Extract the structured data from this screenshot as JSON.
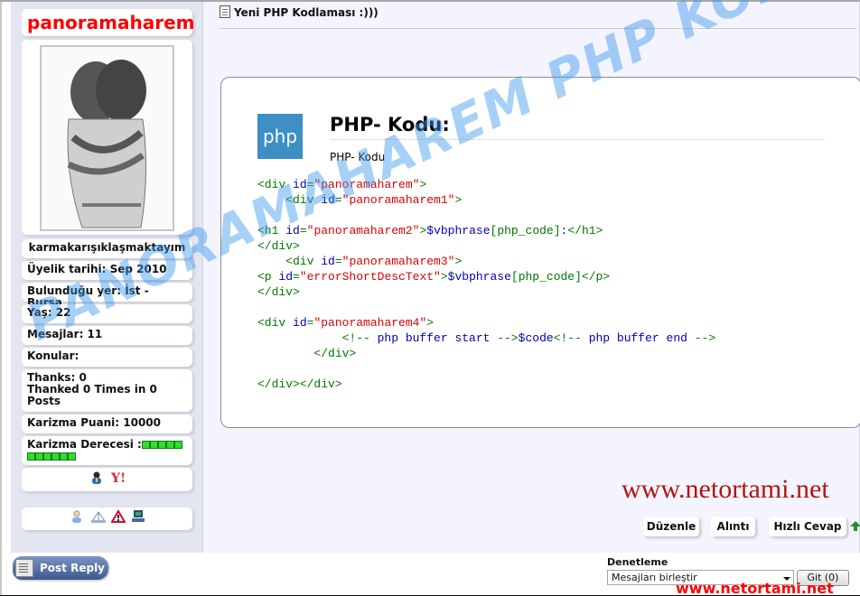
{
  "user": {
    "username": "panoramaharem",
    "title": "karmakarışıklaşmaktayım",
    "join_date": "Üyelik tarihi: Sep 2010",
    "location": "Bulunduğu yer: İst - Bursa",
    "age": "Yaş: 22",
    "posts": "Mesajlar: 11",
    "topics": "Konular:",
    "thanks": "Thanks: 0",
    "thanked": "Thanked 0 Times in 0 Posts",
    "karizma_points": "Karizma Puani: 10000",
    "karizma_level_label": "Karizma Derecesi :",
    "karizma_level_bars": 11,
    "contact_icons": [
      "msn-icon",
      "yahoo-icon"
    ],
    "action_icons": [
      "profile-icon",
      "network-icon",
      "report-icon",
      "computer-icon"
    ]
  },
  "post": {
    "title": "Yeni PHP Kodlaması :)))",
    "code_heading": "PHP- Kodu:",
    "code_subheading": "PHP- Kodu",
    "logo_text": "php",
    "code_lines": [
      [
        [
          "tg",
          "<div "
        ],
        [
          "kw",
          "id"
        ],
        [
          "tg",
          "="
        ],
        [
          "st",
          "\"panoramaharem\""
        ],
        [
          "tg",
          ">"
        ]
      ],
      [
        [
          "tg",
          "    <div "
        ],
        [
          "kw",
          "id"
        ],
        [
          "tg",
          "="
        ],
        [
          "st",
          "\"panoramaharem1\""
        ],
        [
          "tg",
          ">"
        ]
      ],
      [],
      [
        [
          "tg",
          "<h1 "
        ],
        [
          "kw",
          "id"
        ],
        [
          "tg",
          "="
        ],
        [
          "st",
          "\"panoramaharem2\""
        ],
        [
          "tg",
          ">"
        ],
        [
          "kw",
          "$vbphrase"
        ],
        [
          "tg",
          "["
        ],
        [
          "tg",
          "php_code"
        ],
        [
          "tg",
          "]"
        ],
        [
          "kw",
          ":"
        ],
        [
          "tg",
          "</h1>"
        ]
      ],
      [
        [
          "tg",
          "</div>"
        ]
      ],
      [
        [
          "tg",
          "    <div "
        ],
        [
          "kw",
          "id"
        ],
        [
          "tg",
          "="
        ],
        [
          "st",
          "\"panoramaharem3\""
        ],
        [
          "tg",
          ">"
        ]
      ],
      [
        [
          "tg",
          "<p "
        ],
        [
          "kw",
          "id"
        ],
        [
          "tg",
          "="
        ],
        [
          "st",
          "\"errorShortDescText\""
        ],
        [
          "tg",
          ">"
        ],
        [
          "kw",
          "$vbphrase"
        ],
        [
          "tg",
          "[php_code]"
        ],
        [
          "tg",
          "</p>"
        ]
      ],
      [
        [
          "tg",
          "</div>"
        ]
      ],
      [],
      [
        [
          "tg",
          "<div "
        ],
        [
          "kw",
          "id"
        ],
        [
          "tg",
          "="
        ],
        [
          "st",
          "\"panoramaharem4\""
        ],
        [
          "tg",
          ">"
        ]
      ],
      [
        [
          "tg",
          "            <!-- "
        ],
        [
          "cm",
          "php buffer start"
        ],
        [
          "tg",
          " -->"
        ],
        [
          "kw",
          "$code"
        ],
        [
          "tg",
          "<!-- "
        ],
        [
          "cm",
          "php buffer end"
        ],
        [
          "tg",
          " -->"
        ]
      ],
      [
        [
          "tg",
          "        </div>"
        ]
      ],
      [],
      [
        [
          "tg",
          "</div></div>"
        ]
      ]
    ],
    "site_watermark": "www.netortami.net",
    "watermark_overlay": "PANORAMAHAREM PHP KODLAMASI"
  },
  "buttons": {
    "edit": "Düzenle",
    "quote": "Alıntı",
    "quick_reply": "Hızlı Cevap",
    "post_reply": "Post Reply"
  },
  "moderation": {
    "label": "Denetleme",
    "selected_option": "Mesajları birleştir",
    "go_button": "Git (0)"
  },
  "footer_site": "www.netortami.net",
  "colors": {
    "username": "#ff0000",
    "sidebar_bg": "#e3e5f1",
    "content_bg": "#f3f4fd",
    "site_mark": "#b01515",
    "watermark": "#3c96eb"
  }
}
